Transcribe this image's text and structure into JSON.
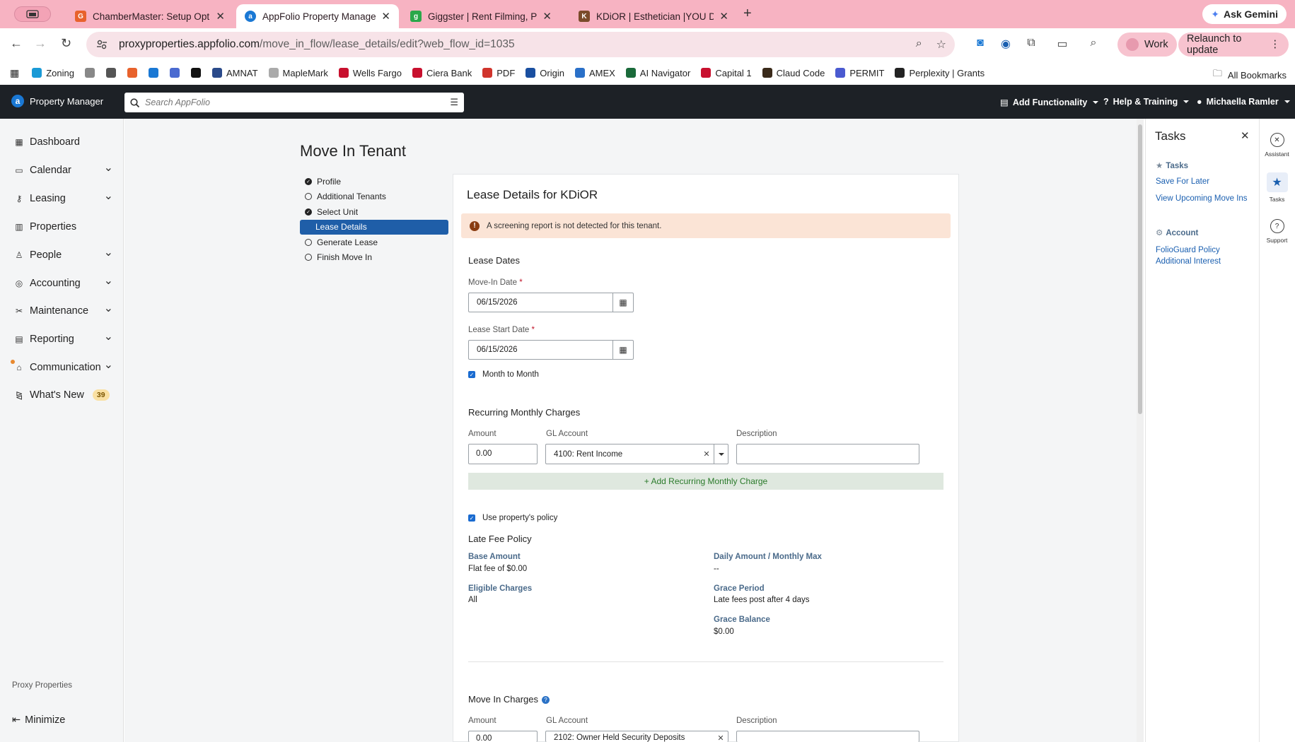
{
  "browser": {
    "tabs": [
      {
        "title": "ChamberMaster: Setup Optio",
        "color": "#e8622c",
        "glyph": "G"
      },
      {
        "title": "AppFolio Property Manager",
        "color": "#1a78d4",
        "glyph": "a"
      },
      {
        "title": "Giggster | Rent Filming, Photo",
        "color": "#2aa84a",
        "glyph": "g"
      },
      {
        "title": "KDiOR | Esthetician |YOU DEF",
        "color": "#7a4b2a",
        "glyph": "K"
      }
    ],
    "gemini": "Ask Gemini",
    "url_host": "proxyproperties.appfolio.com",
    "url_path": "/move_in_flow/lease_details/edit?web_flow_id=1035",
    "work": "Work",
    "relaunch": "Relaunch to update",
    "bookmarks": [
      {
        "label": "Zoning",
        "color": "#1a9ad6"
      },
      {
        "label": "",
        "color": "#888888"
      },
      {
        "label": "",
        "color": "#555555"
      },
      {
        "label": "",
        "color": "#e8622c"
      },
      {
        "label": "",
        "color": "#1a78d4"
      },
      {
        "label": "",
        "color": "#4a6ad0"
      },
      {
        "label": "",
        "color": "#111111"
      },
      {
        "label": "AMNAT",
        "color": "#2a4a8a"
      },
      {
        "label": "MapleMark",
        "color": "#aaaaaa"
      },
      {
        "label": "Wells Fargo",
        "color": "#c8102e"
      },
      {
        "label": "Ciera Bank",
        "color": "#c8102e"
      },
      {
        "label": "PDF",
        "color": "#d0342c"
      },
      {
        "label": "Origin",
        "color": "#1a4fa0"
      },
      {
        "label": "AMEX",
        "color": "#2a70c8"
      },
      {
        "label": "AI Navigator",
        "color": "#1a6a3a"
      },
      {
        "label": "Capital 1",
        "color": "#c8102e"
      },
      {
        "label": "Claud Code",
        "color": "#3a2a1a"
      },
      {
        "label": "PERMIT",
        "color": "#4a5ad0"
      },
      {
        "label": "Perplexity | Grants",
        "color": "#222222"
      }
    ],
    "all_bookmarks": "All Bookmarks"
  },
  "app": {
    "brand": "Property Manager",
    "search_placeholder": "Search AppFolio",
    "add_functionality": "Add Functionality",
    "help_training": "Help & Training",
    "user": "Michaella Ramler"
  },
  "nav": {
    "items": [
      {
        "label": "Dashboard",
        "icon": "grid-icon",
        "chev": false
      },
      {
        "label": "Calendar",
        "icon": "calendar-icon",
        "chev": true
      },
      {
        "label": "Leasing",
        "icon": "key-icon",
        "chev": true
      },
      {
        "label": "Properties",
        "icon": "building-icon",
        "chev": false
      },
      {
        "label": "People",
        "icon": "person-icon",
        "chev": true
      },
      {
        "label": "Accounting",
        "icon": "accounting-icon",
        "chev": true
      },
      {
        "label": "Maintenance",
        "icon": "tools-icon",
        "chev": true
      },
      {
        "label": "Reporting",
        "icon": "table-icon",
        "chev": true
      },
      {
        "label": "Communication",
        "icon": "inbox-icon",
        "chev": true
      },
      {
        "label": "What's New",
        "icon": "megaphone-icon",
        "chev": false,
        "count": "39"
      }
    ],
    "org": "Proxy Properties",
    "minimize": "Minimize"
  },
  "page": {
    "title": "Move In Tenant",
    "steps": [
      {
        "label": "Profile",
        "state": "done"
      },
      {
        "label": "Additional Tenants",
        "state": "todo"
      },
      {
        "label": "Select Unit",
        "state": "done"
      },
      {
        "label": "Lease Details",
        "state": "active"
      },
      {
        "label": "Generate Lease",
        "state": "todo"
      },
      {
        "label": "Finish Move In",
        "state": "todo"
      }
    ],
    "card_title": "Lease Details for KDiOR",
    "alert": "A screening report is not detected for this tenant.",
    "lease_dates": {
      "heading": "Lease Dates",
      "move_in_label": "Move-In Date",
      "move_in_value": "06/15/2026",
      "lease_start_label": "Lease Start Date",
      "lease_start_value": "06/15/2026",
      "month_to_month": "Month to Month",
      "required": "*"
    },
    "recurring": {
      "heading": "Recurring Monthly Charges",
      "col_amount": "Amount",
      "col_gl": "GL Account",
      "col_desc": "Description",
      "amount": "0.00",
      "gl": "4100: Rent Income",
      "description": "",
      "add": "+ Add Recurring Monthly Charge"
    },
    "late_fee": {
      "use_policy": "Use property's policy",
      "heading": "Late Fee Policy",
      "base_amount_k": "Base Amount",
      "base_amount_v": "Flat fee of $0.00",
      "eligible_k": "Eligible Charges",
      "eligible_v": "All",
      "daily_k": "Daily Amount / Monthly Max",
      "daily_v": "--",
      "grace_period_k": "Grace Period",
      "grace_period_v": "Late fees post after 4 days",
      "grace_balance_k": "Grace Balance",
      "grace_balance_v": "$0.00"
    },
    "move_in_charges": {
      "heading": "Move In Charges",
      "col_amount": "Amount",
      "col_gl": "GL Account",
      "col_desc": "Description",
      "amount": "0.00",
      "gl": "2102: Owner Held Security Deposits"
    }
  },
  "tasks": {
    "title": "Tasks",
    "section_tasks": "Tasks",
    "save_later": "Save For Later",
    "upcoming": "View Upcoming Move Ins",
    "section_account": "Account",
    "folioguard": "FolioGuard Policy Additional Interest"
  },
  "rail": {
    "assistant": "Assistant",
    "tasks": "Tasks",
    "support": "Support"
  }
}
